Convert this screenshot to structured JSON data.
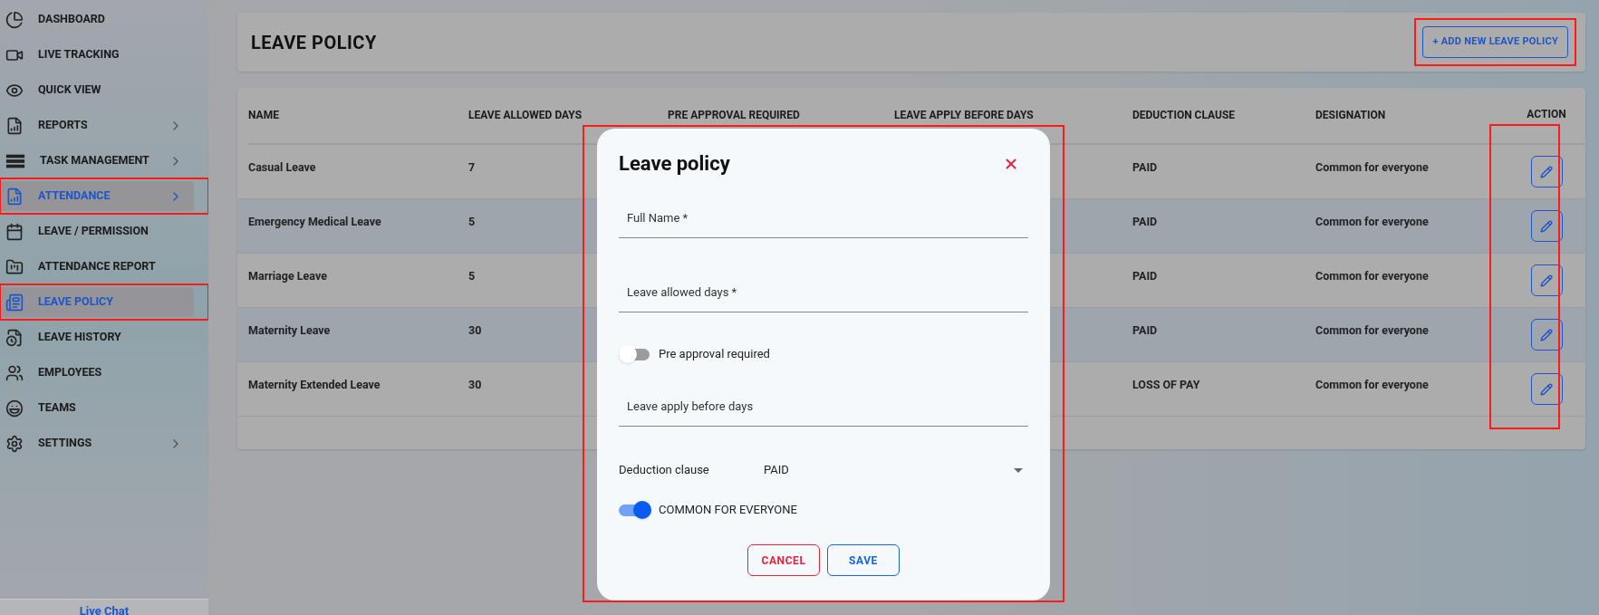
{
  "sidebar": {
    "items": [
      {
        "label": "DASHBOARD",
        "selected": false,
        "expandable": false,
        "highlighted": false
      },
      {
        "label": "LIVE TRACKING",
        "selected": false,
        "expandable": false,
        "highlighted": false
      },
      {
        "label": "QUICK VIEW",
        "selected": false,
        "expandable": false,
        "highlighted": false
      },
      {
        "label": "REPORTS",
        "selected": false,
        "expandable": true,
        "highlighted": false
      },
      {
        "label": "TASK MANAGEMENT",
        "selected": false,
        "expandable": true,
        "highlighted": false
      },
      {
        "label": "ATTENDANCE",
        "selected": true,
        "expandable": true,
        "highlighted": true
      },
      {
        "label": "LEAVE / PERMISSION",
        "selected": false,
        "expandable": false,
        "highlighted": false
      },
      {
        "label": "ATTENDANCE REPORT",
        "selected": false,
        "expandable": false,
        "highlighted": false
      },
      {
        "label": "LEAVE POLICY",
        "selected": true,
        "expandable": false,
        "highlighted": true
      },
      {
        "label": "LEAVE HISTORY",
        "selected": false,
        "expandable": false,
        "highlighted": false
      },
      {
        "label": "EMPLOYEES",
        "selected": false,
        "expandable": false,
        "highlighted": false
      },
      {
        "label": "TEAMS",
        "selected": false,
        "expandable": false,
        "highlighted": false
      },
      {
        "label": "SETTINGS",
        "selected": false,
        "expandable": true,
        "highlighted": false
      }
    ],
    "footer_link": "Live Chat"
  },
  "header": {
    "title": "LEAVE POLICY",
    "add_button": {
      "label": "+ ADD NEW LEAVE POLICY",
      "highlighted": true
    }
  },
  "table": {
    "columns": [
      "NAME",
      "LEAVE ALLOWED DAYS",
      "PRE APPROVAL REQUIRED",
      "LEAVE APPLY BEFORE DAYS",
      "DEDUCTION CLAUSE",
      "DESIGNATION",
      "ACTION"
    ],
    "action_column_highlighted": true,
    "rows": [
      {
        "name": "Casual Leave",
        "allowed_days": "7",
        "deduction": "PAID",
        "designation": "Common for everyone"
      },
      {
        "name": "Emergency Medical Leave",
        "allowed_days": "5",
        "deduction": "PAID",
        "designation": "Common for everyone"
      },
      {
        "name": "Marriage Leave",
        "allowed_days": "5",
        "deduction": "PAID",
        "designation": "Common for everyone"
      },
      {
        "name": "Maternity Leave",
        "allowed_days": "30",
        "deduction": "PAID",
        "designation": "Common for everyone"
      },
      {
        "name": "Maternity Extended Leave",
        "allowed_days": "30",
        "deduction": "LOSS OF PAY",
        "designation": "Common for everyone"
      }
    ]
  },
  "dialog": {
    "title": "Leave policy",
    "highlighted": true,
    "fields": [
      {
        "kind": "text",
        "placeholder": "Full Name *"
      },
      {
        "kind": "text",
        "placeholder": "Leave allowed days *"
      },
      {
        "kind": "toggle",
        "label": "Pre approval required",
        "on": false
      },
      {
        "kind": "text",
        "placeholder": "Leave apply before days"
      },
      {
        "kind": "select",
        "label": "Deduction clause",
        "value": "PAID"
      },
      {
        "kind": "toggle",
        "label": "COMMON FOR EVERYONE",
        "on": true
      }
    ],
    "buttons": [
      {
        "kind": "cancel",
        "label": "CANCEL"
      },
      {
        "kind": "save",
        "label": "SAVE"
      }
    ]
  }
}
